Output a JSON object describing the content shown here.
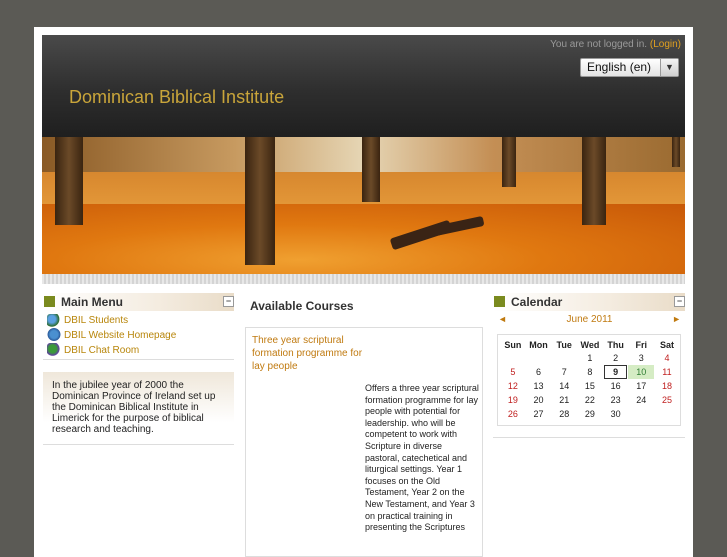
{
  "header": {
    "login_text": "You are not logged in.",
    "login_link": "(Login)",
    "language": "English (en)",
    "site_title": "Dominican Biblical Institute"
  },
  "main_menu": {
    "title": "Main Menu",
    "collapse": "−",
    "items": [
      {
        "label": "DBIL Students",
        "icon": "students-icon"
      },
      {
        "label": "DBIL Website Homepage",
        "icon": "web-link-icon"
      },
      {
        "label": "DBIL Chat Room",
        "icon": "chat-icon"
      }
    ]
  },
  "jubilee_text": "In the jubilee year of 2000 the Dominican Province of Ireland set up the Dominican Biblical Institute in Limerick for the purpose of biblical research and teaching.",
  "courses": {
    "title": "Available Courses",
    "course_name": "Three year scriptural formation programme for lay people",
    "course_summary": "Offers a three year scriptural formation programme for lay people with potential for leadership. who will be competent to work with Scripture in diverse pastoral, catechetical and liturgical settings. Year 1 focuses on the Old Testament, Year 2 on the New Testament, and Year 3 on practical training in presenting the Scriptures"
  },
  "calendar": {
    "title": "Calendar",
    "collapse": "−",
    "prev": "◄",
    "next": "►",
    "month": "June 2011",
    "weekdays": [
      "Sun",
      "Mon",
      "Tue",
      "Wed",
      "Thu",
      "Fri",
      "Sat"
    ],
    "weeks": [
      [
        "",
        "",
        "",
        "1",
        "2",
        "3",
        "4"
      ],
      [
        "5",
        "6",
        "7",
        "8",
        "9",
        "10",
        "11"
      ],
      [
        "12",
        "13",
        "14",
        "15",
        "16",
        "17",
        "18"
      ],
      [
        "19",
        "20",
        "21",
        "22",
        "23",
        "24",
        "25"
      ],
      [
        "26",
        "27",
        "28",
        "29",
        "30",
        "",
        ""
      ]
    ],
    "today": "9",
    "event_day": "10"
  },
  "colors": {
    "accent_link": "#c07a10",
    "title_gold": "#c9a53a",
    "block_square": "#7a8a1e",
    "weekend_red": "#c02020"
  }
}
